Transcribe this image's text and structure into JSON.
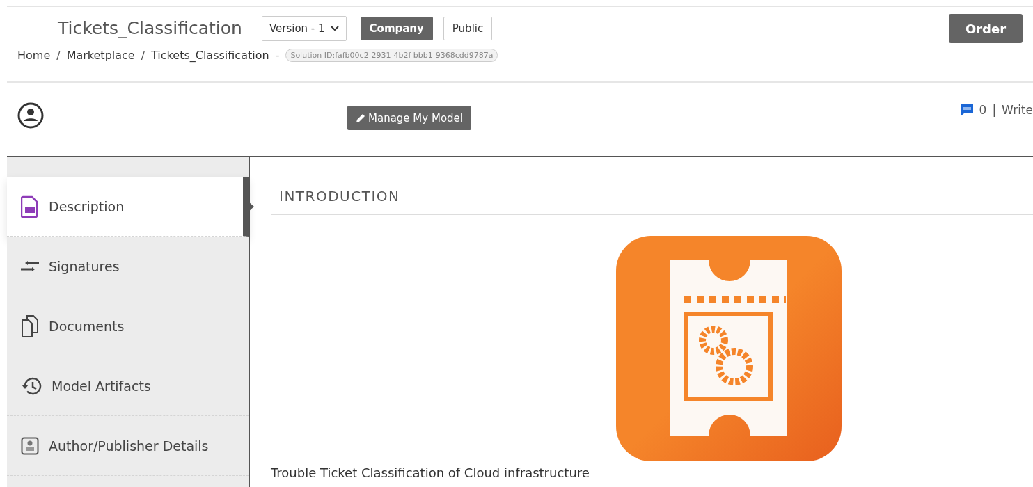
{
  "header": {
    "title": "Tickets_Classification",
    "version": "Version - 1",
    "visibility_options": [
      {
        "label": "Company",
        "selected": true
      },
      {
        "label": "Public",
        "selected": false
      }
    ],
    "order_button": "Order",
    "breadcrumb": [
      "Home",
      "Marketplace",
      "Tickets_Classification"
    ],
    "breadcrumb_separator": "/",
    "breadcrumb_dash": "-",
    "solution_id": "Solution ID:fafb00c2-2931-4b2f-bbb1-9368cdd9787a"
  },
  "user_bar": {
    "manage_button": "Manage My Model",
    "comment_count": "0",
    "separator": "|",
    "write_link": "Write"
  },
  "sidebar": {
    "items": [
      {
        "label": "Description",
        "selected": true
      },
      {
        "label": "Signatures",
        "selected": false
      },
      {
        "label": "Documents",
        "selected": false
      },
      {
        "label": "Model Artifacts",
        "selected": false
      },
      {
        "label": "Author/Publisher Details",
        "selected": false
      }
    ]
  },
  "content": {
    "heading": "INTRODUCTION",
    "description": "Trouble Ticket Classification of Cloud infrastructure"
  }
}
